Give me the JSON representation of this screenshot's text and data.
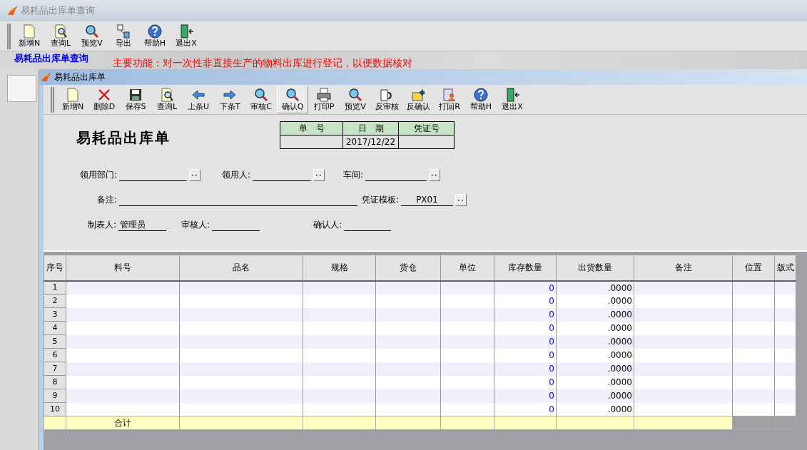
{
  "window": {
    "title": "易耗品出库单查询"
  },
  "toolbar": [
    {
      "label": "新增N"
    },
    {
      "label": "查询L"
    },
    {
      "label": "预览V"
    },
    {
      "label": "导出"
    },
    {
      "label": "帮助H"
    },
    {
      "label": "退出X"
    }
  ],
  "page_heading": "易耗品出库单查询",
  "notice": "主要功能：对一次性非直接生产的物料出库进行登记，以便数据核对",
  "dialog": {
    "title": "易耗品出库单",
    "toolbar": [
      {
        "label": "新增N",
        "selected": false
      },
      {
        "label": "删除D",
        "selected": false
      },
      {
        "label": "保存S",
        "selected": false
      },
      {
        "label": "查询L",
        "selected": false
      },
      {
        "label": "上条U",
        "selected": false
      },
      {
        "label": "下条T",
        "selected": false
      },
      {
        "label": "审核C",
        "selected": false
      },
      {
        "label": "确认Q",
        "selected": true
      },
      {
        "label": "打印P",
        "selected": false
      },
      {
        "label": "预览V",
        "selected": false
      },
      {
        "label": "反审核",
        "selected": false
      },
      {
        "label": "反确认",
        "selected": false
      },
      {
        "label": "打回R",
        "selected": false
      },
      {
        "label": "帮助H",
        "selected": false
      },
      {
        "label": "退出X",
        "selected": false
      }
    ],
    "form_title": "易耗品出库单",
    "doc_info": [
      {
        "header": "单　号"
      },
      {
        "header": "日　期",
        "value": "2017/12/22"
      },
      {
        "header": "凭证号"
      }
    ],
    "field_rows": [
      [
        {
          "label": "领用部门:",
          "picker": true
        },
        {
          "label": "领用人:",
          "picker": true
        },
        {
          "label": "车间:",
          "picker": true
        }
      ],
      [
        {
          "label": "备注:",
          "picker": false
        },
        {
          "label": "凭证模板:",
          "value": "PX01",
          "picker": true
        }
      ],
      [
        {
          "label": "制表人:",
          "value": "管理员",
          "picker": false
        },
        {
          "label": "审核人:",
          "picker": false
        },
        {
          "label": "确认人:",
          "picker": false
        }
      ]
    ],
    "table": {
      "columns": [
        "序号",
        "料号",
        "品名",
        "规格",
        "货仓",
        "单位",
        "库存数量",
        "出货数量",
        "备注",
        "位置",
        "版式"
      ],
      "rows": [
        {
          "no": "1",
          "stock": "0",
          "qty": ".0000"
        },
        {
          "no": "2",
          "stock": "0",
          "qty": ".0000"
        },
        {
          "no": "3",
          "stock": "0",
          "qty": ".0000"
        },
        {
          "no": "4",
          "stock": "0",
          "qty": ".0000"
        },
        {
          "no": "5",
          "stock": "0",
          "qty": ".0000"
        },
        {
          "no": "6",
          "stock": "0",
          "qty": ".0000"
        },
        {
          "no": "7",
          "stock": "0",
          "qty": ".0000"
        },
        {
          "no": "8",
          "stock": "0",
          "qty": ".0000"
        },
        {
          "no": "9",
          "stock": "0",
          "qty": ".0000"
        },
        {
          "no": "10",
          "stock": "0",
          "qty": ".0000"
        }
      ],
      "total_label": "合计"
    }
  }
}
